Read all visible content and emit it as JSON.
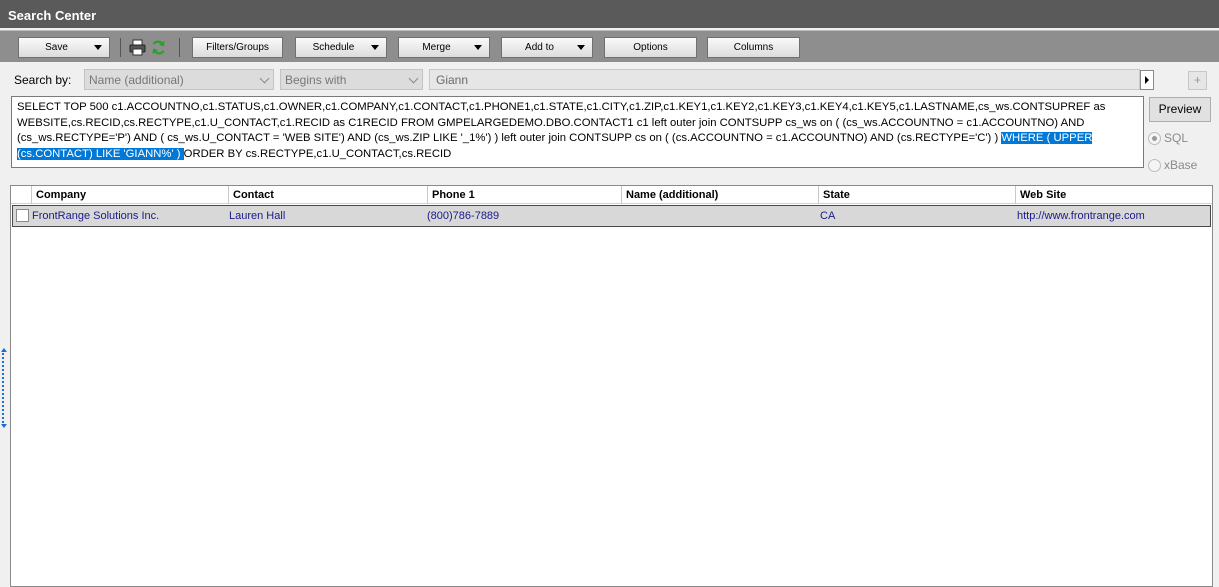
{
  "window": {
    "title": "Search Center"
  },
  "toolbar": {
    "save_label": "Save",
    "filters_label": "Filters/Groups",
    "schedule_label": "Schedule",
    "merge_label": "Merge",
    "addto_label": "Add to",
    "options_label": "Options",
    "columns_label": "Columns"
  },
  "search": {
    "label": "Search by:",
    "field": "Name (additional)",
    "operator": "Begins with",
    "value": "Giann",
    "plus_label": "+"
  },
  "sql": {
    "text_before": "SELECT TOP 500 c1.ACCOUNTNO,c1.STATUS,c1.OWNER,c1.COMPANY,c1.CONTACT,c1.PHONE1,c1.STATE,c1.CITY,c1.ZIP,c1.KEY1,c1.KEY2,c1.KEY3,c1.KEY4,c1.KEY5,c1.LASTNAME,cs_ws.CONTSUPREF as WEBSITE,cs.RECID,cs.RECTYPE,c1.U_CONTACT,c1.RECID as C1RECID  FROM GMPELARGEDEMO.DBO.CONTACT1 c1 left outer join CONTSUPP cs_ws on (  (cs_ws.ACCOUNTNO = c1.ACCOUNTNO) AND (cs_ws.RECTYPE='P') AND ( cs_ws.U_CONTACT = 'WEB SITE') AND (cs_ws.ZIP LIKE '_1%')  ) left outer join CONTSUPP cs on (  (cs.ACCOUNTNO = c1.ACCOUNTNO) AND (cs.RECTYPE='C') ) ",
    "text_highlight": " WHERE  ( UPPER (cs.CONTACT) LIKE 'GIANN%' ) ",
    "text_after": "  ORDER BY cs.RECTYPE,c1.U_CONTACT,cs.RECID",
    "preview_label": "Preview",
    "mode_sql": "SQL",
    "mode_xbase": "xBase"
  },
  "grid": {
    "columns": [
      "Company",
      "Contact",
      "Phone 1",
      "Name (additional)",
      "State",
      "Web Site"
    ],
    "rows": [
      {
        "company": "FrontRange Solutions Inc.",
        "contact": "Lauren Hall",
        "phone": "(800)786-7889",
        "name_additional": "",
        "state": "CA",
        "website": "http://www.frontrange.com"
      }
    ]
  }
}
